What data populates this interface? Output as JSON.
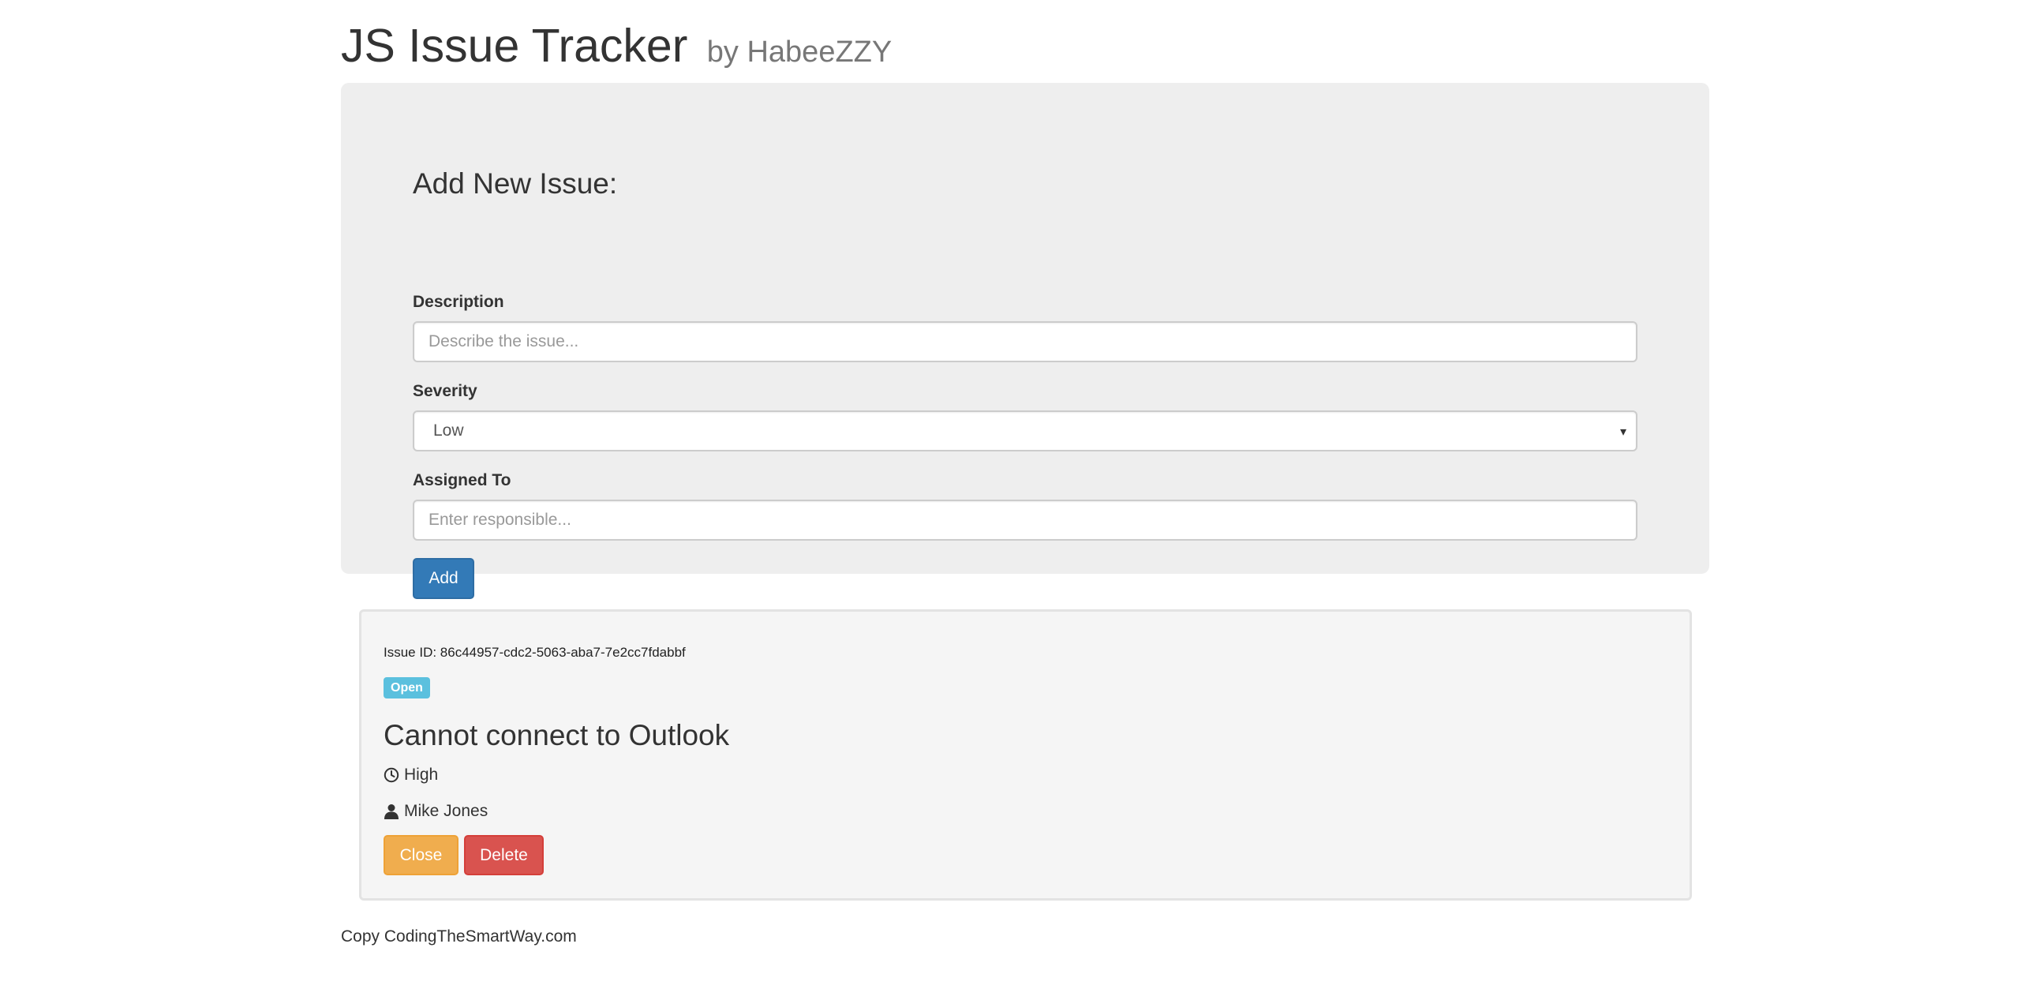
{
  "header": {
    "title": "JS Issue Tracker",
    "subtitle": "by HabeeZZY"
  },
  "form": {
    "heading": "Add New Issue:",
    "description_label": "Description",
    "description_placeholder": "Describe the issue...",
    "severity_label": "Severity",
    "severity_value": "Low",
    "assigned_label": "Assigned To",
    "assigned_placeholder": "Enter responsible...",
    "add_label": "Add"
  },
  "issues": [
    {
      "id_text": "Issue ID: 86c44957-cdc2-5063-aba7-7e2cc7fdabbf",
      "status": "Open",
      "description": "Cannot connect to Outlook",
      "severity": "High",
      "assigned_to": "Mike Jones",
      "close_label": "Close",
      "delete_label": "Delete"
    }
  ],
  "footer": {
    "text": "Copy CodingTheSmartWay.com"
  },
  "colors": {
    "primary": "#337ab7",
    "warning": "#f0ad4e",
    "danger": "#d9534f",
    "info": "#5bc0de",
    "jumbotron_bg": "#eeeeee"
  },
  "icons": {
    "severity": "clock-icon",
    "assignee": "user-icon",
    "dropdown": "caret-down-icon"
  }
}
